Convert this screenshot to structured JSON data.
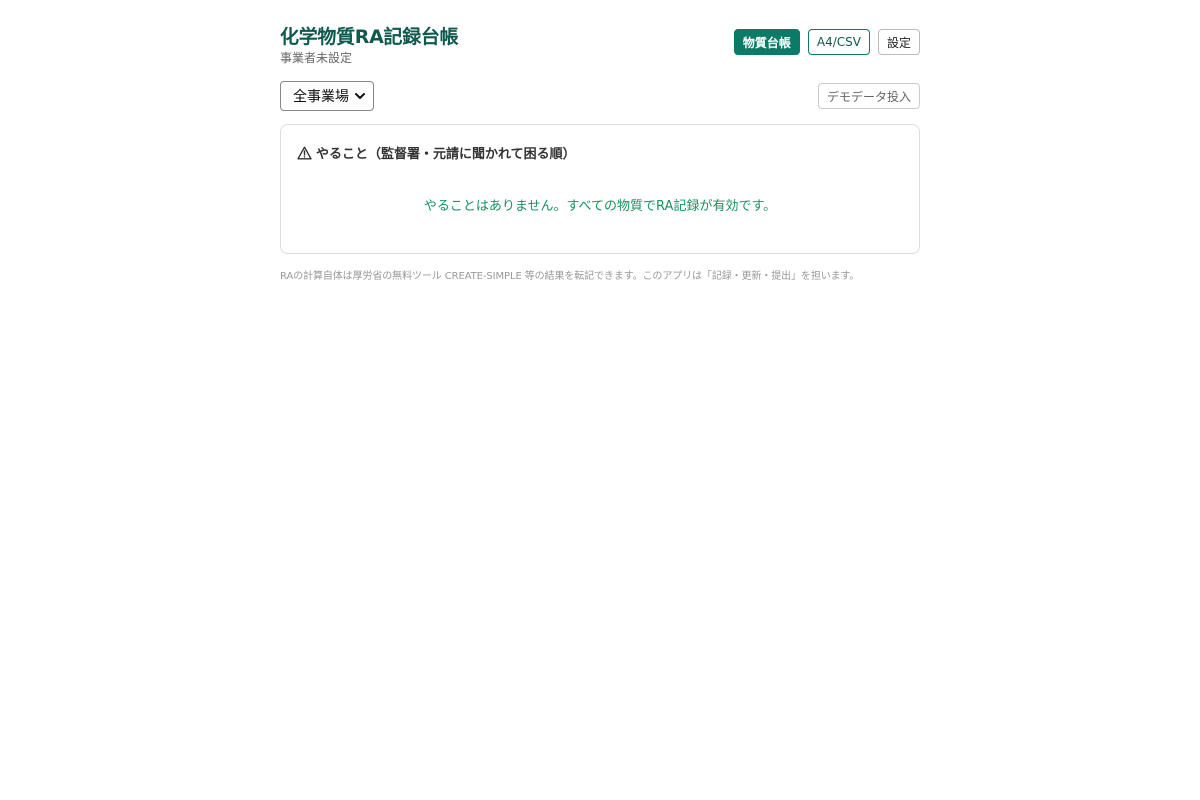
{
  "header": {
    "title": "化学物質RA記録台帳",
    "subtitle": "事業者未設定"
  },
  "nav": {
    "items": [
      {
        "label": "物質台帳",
        "active": true
      },
      {
        "label": "A4/CSV",
        "active": false
      },
      {
        "label": "設定",
        "active": false
      }
    ]
  },
  "toolbar": {
    "site_select": {
      "value": "全事業場"
    },
    "demo_button": "デモデータ投入"
  },
  "todo": {
    "heading": "やること（監督署・元請に聞かれて困る順）",
    "icon": "warning-icon",
    "empty_message": "やることはありません。すべての物質でRA記録が有効です。"
  },
  "footer": {
    "note": "RAの計算自体は厚労省の無料ツール CREATE-SIMPLE 等の結果を転記できます。このアプリは「記録・更新・提出」を担います。"
  },
  "colors": {
    "brand": "#0b7a67",
    "title": "#0f5a4f",
    "success": "#17925f"
  }
}
